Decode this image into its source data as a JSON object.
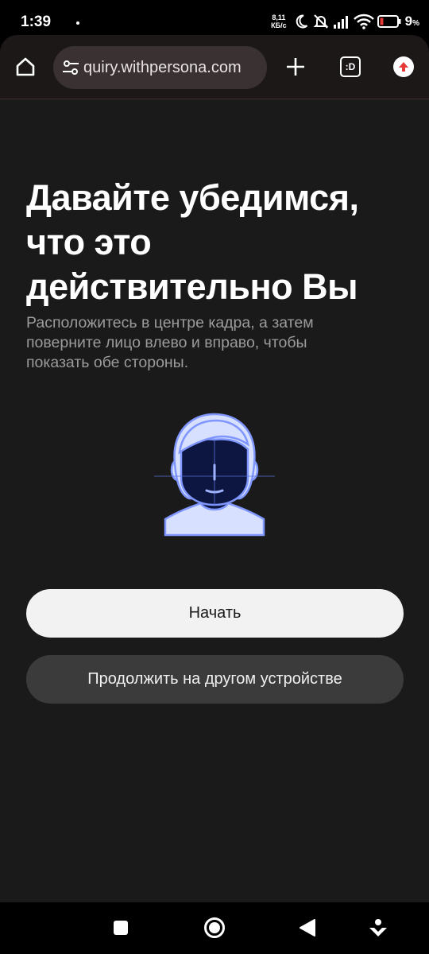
{
  "status_bar": {
    "time": "1:39",
    "net_speed_value": "8,11",
    "net_speed_unit": "КБ/с",
    "battery_percent": "9",
    "battery_suffix": "%",
    "icons": [
      "moon-icon",
      "bell-off-icon",
      "signal-icon",
      "wifi-icon",
      "battery-icon"
    ]
  },
  "browser": {
    "url": "quiry.withpersona.com",
    "tabs_label": ":D",
    "icons": [
      "home-icon",
      "tune-icon",
      "plus-icon",
      "tabs-icon",
      "update-icon"
    ]
  },
  "content": {
    "title_line1": "Давайте убедимся,",
    "title_line2": "что это",
    "title_line3": "действительно Вы",
    "subtitle_line1": "Расположитесь в центре кадра, а затем",
    "subtitle_line2": "поверните лицо влево и вправо, чтобы",
    "subtitle_line3": "показать обе стороны.",
    "illustration": "face-scan-icon",
    "primary_button": "Начать",
    "secondary_button": "Продолжить на другом устройстве"
  },
  "nav": {
    "icons": [
      "recents-square-icon",
      "home-circle-icon",
      "back-triangle-icon",
      "assistant-icon"
    ]
  },
  "colors": {
    "page_bg": "#1a1a1a",
    "toolbar_bg": "#1c1818",
    "url_pill_bg": "#3a3232",
    "primary_button_bg": "#f2f2f2",
    "secondary_button_bg": "#3b3b3b",
    "subtitle_text": "#9b9b9b",
    "illustration_accent": "#8ea3ff",
    "update_badge": "#e53935"
  }
}
